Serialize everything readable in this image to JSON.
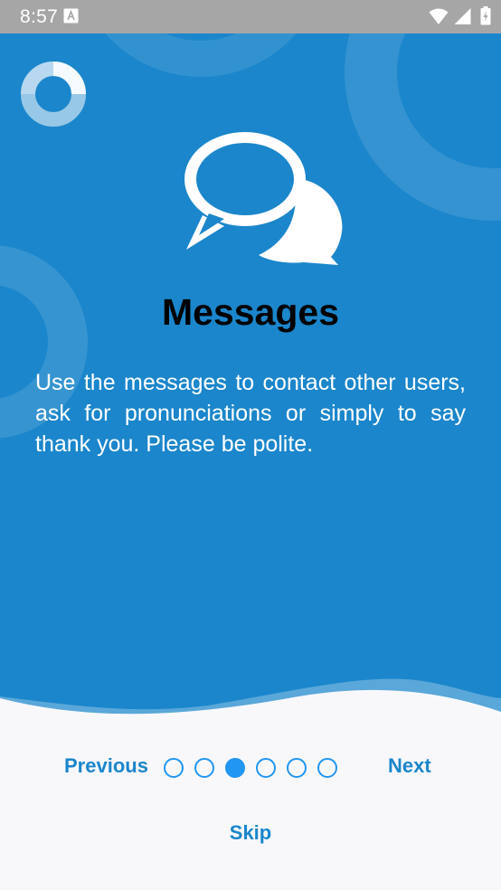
{
  "status_bar": {
    "time": "8:57",
    "notification_icon": "text-notification-icon",
    "icons": [
      "wifi-icon",
      "signal-icon",
      "battery-icon"
    ]
  },
  "colors": {
    "primary_blue": "#1b86cb",
    "accent_blue": "#2196f3",
    "bottom_panel": "#f8f8fb",
    "status_bar": "#a6a6a6"
  },
  "slide": {
    "icon": "chat-bubbles-icon",
    "title": "Messages",
    "description": "Use the messages to contact other users, ask for pronunciations or simply to say thank you. Please be polite."
  },
  "navigation": {
    "previous_label": "Previous",
    "next_label": "Next",
    "skip_label": "Skip",
    "page_count": 6,
    "current_page": 3
  }
}
